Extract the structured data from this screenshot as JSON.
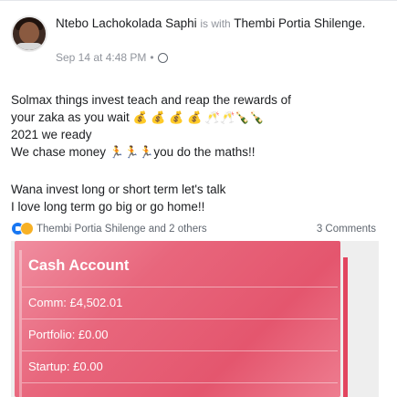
{
  "post": {
    "author": "Ntebo Lachokolada Saphi",
    "with_word": "is with",
    "tagged_person": "Thembi Portia Shilenge",
    "end_punct": ".",
    "timestamp": "Sep 14 at 4:48 PM",
    "separator": "•",
    "privacy_icon": "globe-icon",
    "paragraph1": {
      "line1": "Solmax things invest teach and reap the rewards of",
      "line2_text": "your zaka as you wait",
      "line2_emojis": "💰 💰 💰 💰 🥂🥂🍾🍾",
      "line3": "2021 we ready",
      "line4_start": "We chase money",
      "line4_emojis": "🏃🏃🏃",
      "line4_end": "you do the maths!!"
    },
    "paragraph2": {
      "line1": "Wana invest long or short term let's talk",
      "line2": "I love long term go big or go home!!"
    },
    "reactions_label": "Thembi Portia Shilenge and 2 others",
    "comments_label": "3 Comments",
    "reaction_icons": [
      "like-icon",
      "care-icon"
    ]
  },
  "card": {
    "title": "Cash Account",
    "rows": [
      "Comm: £4,502.01",
      "Portfolio: £0.00",
      "Startup: £0.00"
    ]
  },
  "colors": {
    "like": "#1877f2",
    "card_pink": "#e8667c",
    "muted": "#90949c"
  }
}
